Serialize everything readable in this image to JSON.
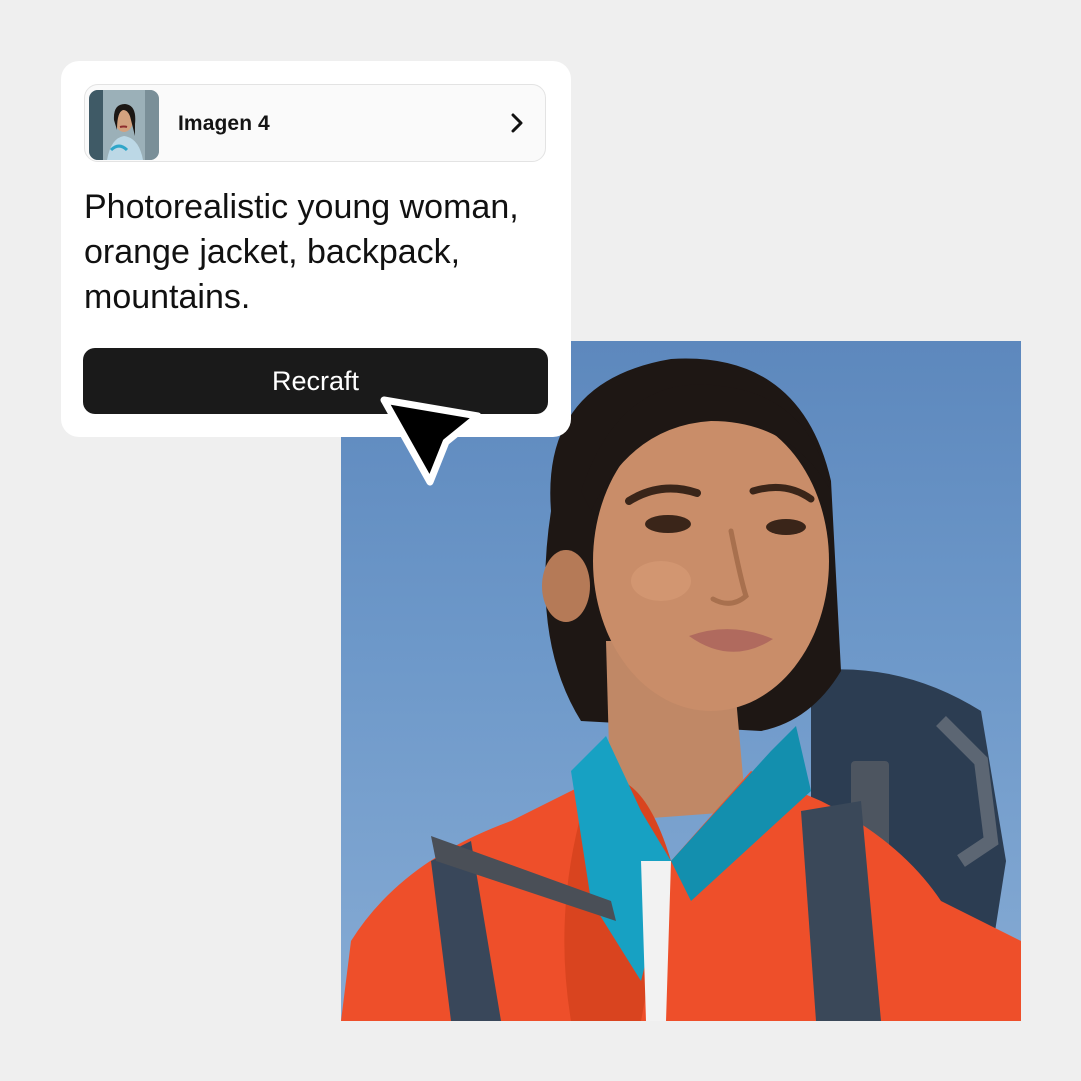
{
  "card": {
    "model": {
      "name": "Imagen 4",
      "thumbnail_icon": "model-thumbnail",
      "chevron_icon": "chevron-right-icon"
    },
    "prompt_text": "Photorealistic young woman, orange jacket, backpack, mountains.",
    "action_label": "Recraft"
  },
  "cursor": {
    "icon": "arrow-cursor-icon"
  },
  "colors": {
    "background": "#efefef",
    "card": "#ffffff",
    "button": "#1a1a1a",
    "button_text": "#ffffff",
    "sky": "#6d98c9",
    "jacket": "#f0502a",
    "collar": "#1aa3c4"
  }
}
